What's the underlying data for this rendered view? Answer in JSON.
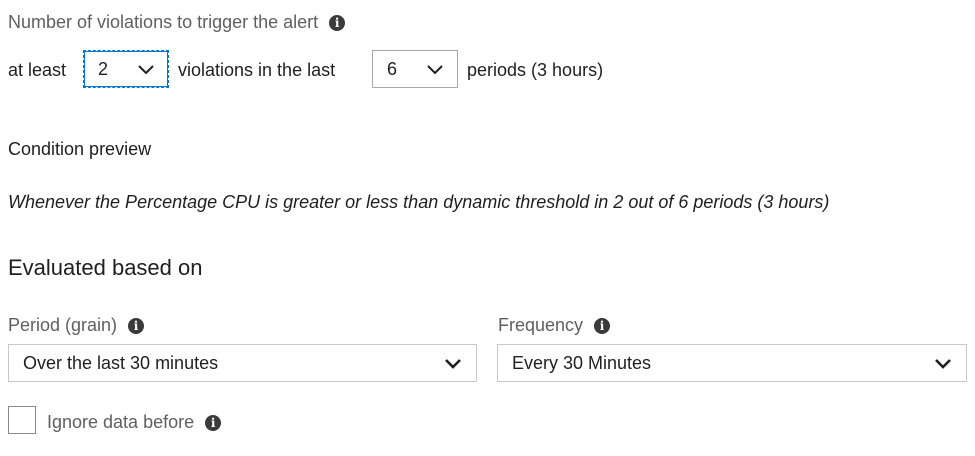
{
  "violations": {
    "heading": "Number of violations to trigger the alert",
    "prefix": "at least",
    "violations_value": "2",
    "middle": "violations in the last",
    "periods_value": "6",
    "suffix": "periods (3 hours)"
  },
  "preview": {
    "heading": "Condition preview",
    "text": "Whenever the Percentage CPU is greater or less than dynamic threshold in 2 out of 6 periods (3 hours)"
  },
  "evaluated": {
    "heading": "Evaluated based on",
    "period_label": "Period (grain)",
    "period_value": "Over the last 30 minutes",
    "frequency_label": "Frequency",
    "frequency_value": "Every 30 Minutes"
  },
  "ignore": {
    "label": "Ignore data before",
    "checked": false
  },
  "colors": {
    "focus_border": "#0078d4",
    "muted_text": "#5f5f5f",
    "border": "#c8c8c8"
  }
}
